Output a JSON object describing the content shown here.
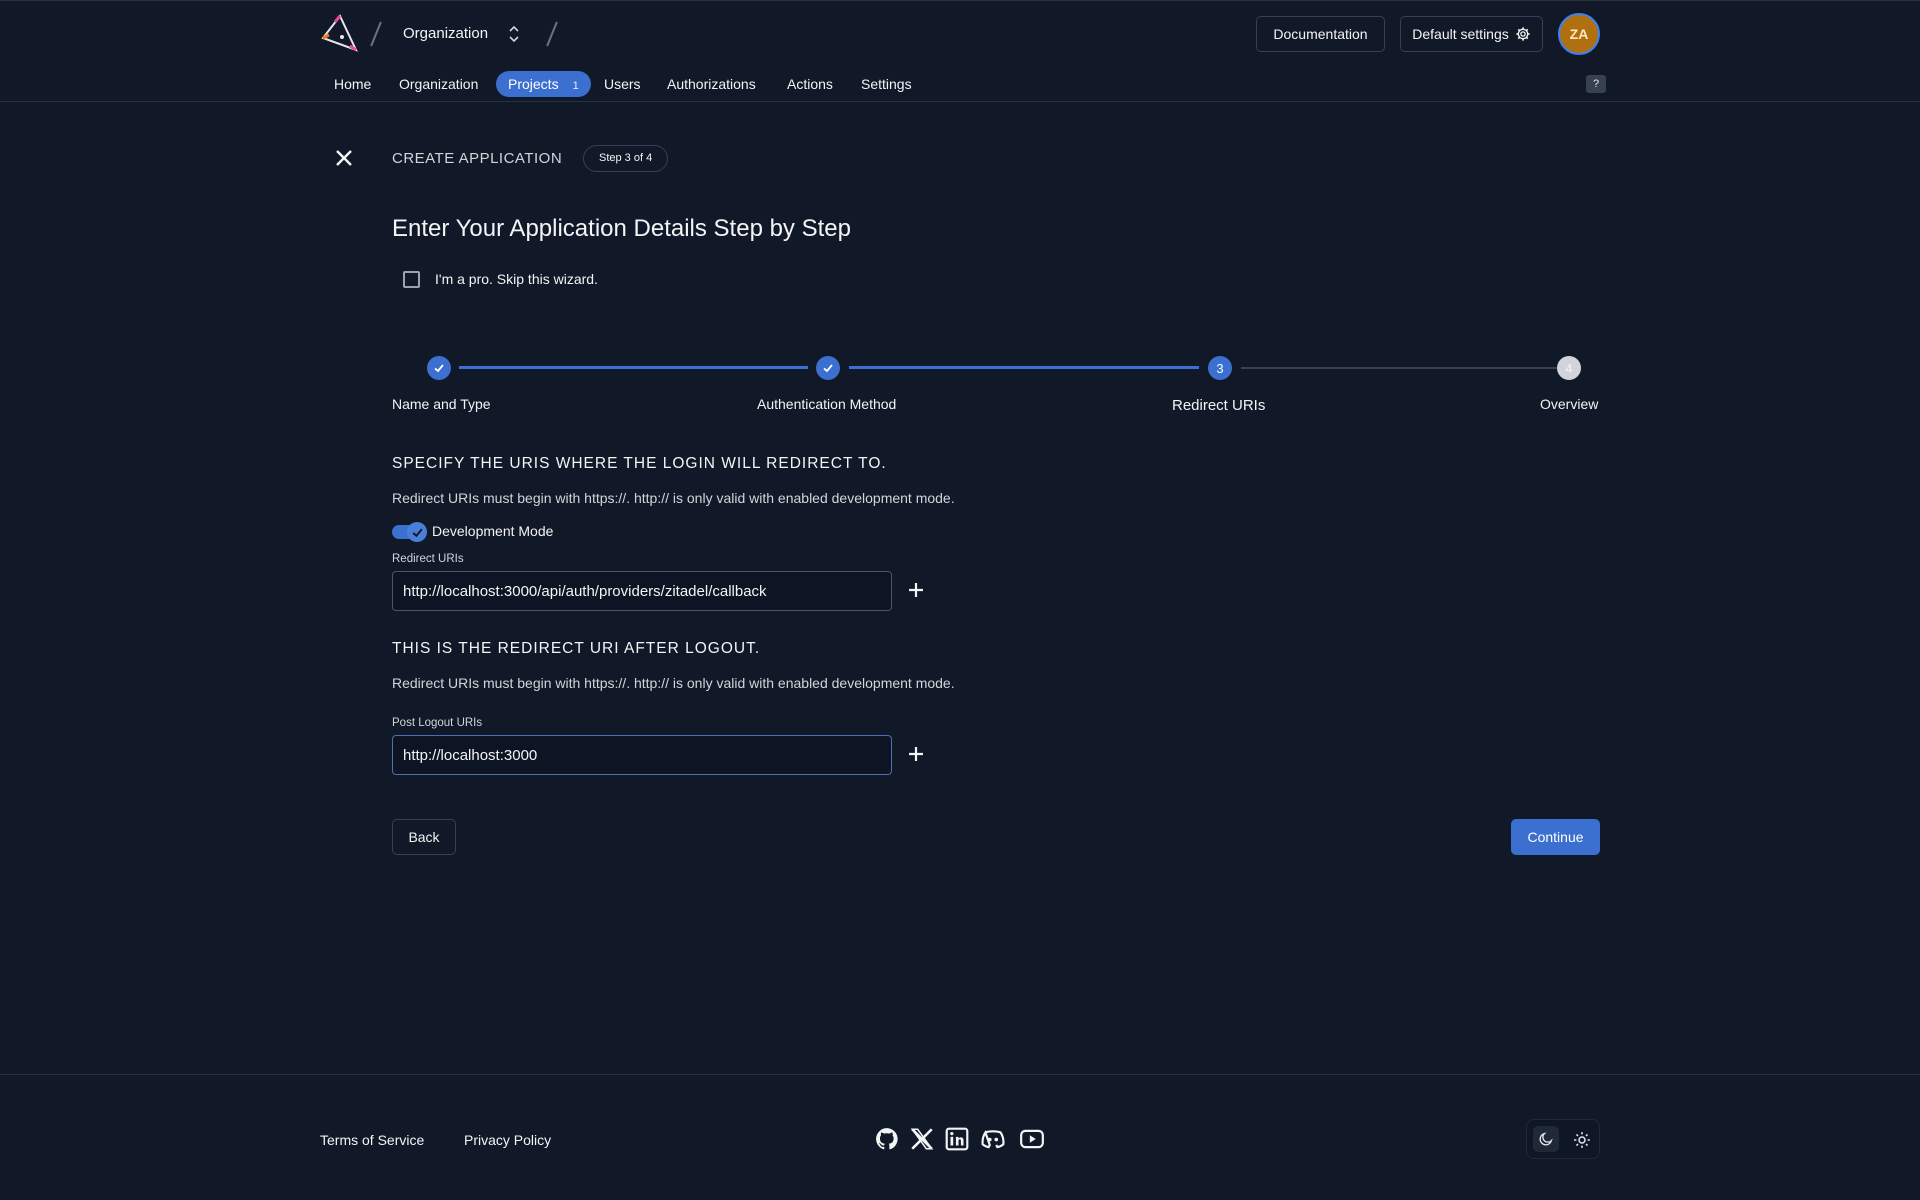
{
  "header": {
    "org_name": "Organization",
    "docs_label": "Documentation",
    "default_settings_label": "Default settings",
    "avatar_initials": "ZA",
    "nav": [
      {
        "label": "Home"
      },
      {
        "label": "Organization"
      },
      {
        "label": "Projects",
        "badge": "1"
      },
      {
        "label": "Users"
      },
      {
        "label": "Authorizations"
      },
      {
        "label": "Actions"
      },
      {
        "label": "Settings"
      }
    ],
    "help_label": "?"
  },
  "wizard": {
    "title": "CREATE APPLICATION",
    "step_pill": "Step 3 of 4",
    "heading": "Enter Your Application Details Step by Step",
    "skip_label": "I'm a pro. Skip this wizard.",
    "steps": [
      {
        "label": "Name and Type",
        "state": "done"
      },
      {
        "label": "Authentication Method",
        "state": "done"
      },
      {
        "label": "Redirect URIs",
        "state": "current",
        "number": "3"
      },
      {
        "label": "Overview",
        "state": "todo",
        "number": "4"
      }
    ]
  },
  "redirect_section": {
    "heading": "SPECIFY THE URIS WHERE THE LOGIN WILL REDIRECT TO.",
    "description": "Redirect URIs must begin with https://. http:// is only valid with enabled development mode.",
    "dev_mode_label": "Development Mode",
    "dev_mode_on": true,
    "field_label": "Redirect URIs",
    "field_value": "http://localhost:3000/api/auth/providers/zitadel/callback"
  },
  "logout_section": {
    "heading": "THIS IS THE REDIRECT URI AFTER LOGOUT.",
    "description": "Redirect URIs must begin with https://. http:// is only valid with enabled development mode.",
    "field_label": "Post Logout URIs",
    "field_value": "http://localhost:3000"
  },
  "actions": {
    "back_label": "Back",
    "continue_label": "Continue"
  },
  "footer": {
    "terms_label": "Terms of Service",
    "privacy_label": "Privacy Policy",
    "social_icons": [
      "github-icon",
      "x-icon",
      "linkedin-icon",
      "discord-icon",
      "youtube-icon"
    ]
  },
  "colors": {
    "background": "#111827",
    "accent": "#3b6fd0",
    "avatar": "#b0700f"
  }
}
